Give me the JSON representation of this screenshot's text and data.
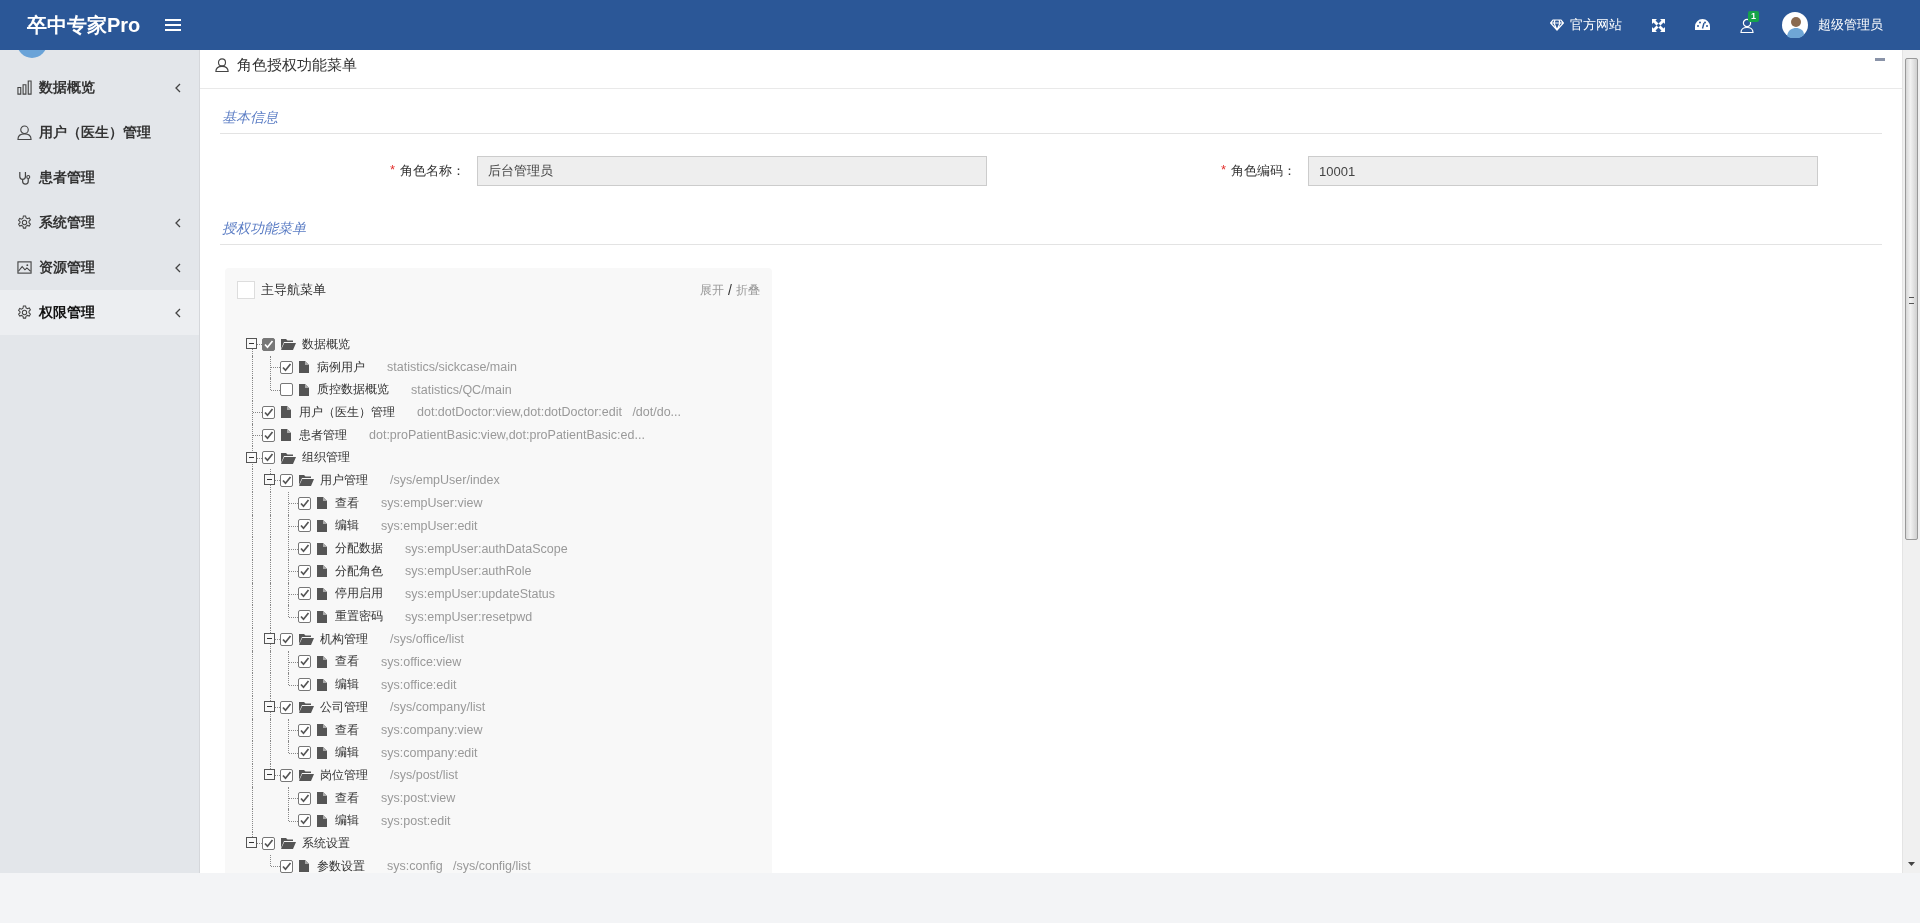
{
  "header": {
    "brand": "卒中专家Pro",
    "links": [
      {
        "kind": "website",
        "label": "官方网站"
      },
      {
        "kind": "fullscreen"
      },
      {
        "kind": "dashboard"
      },
      {
        "kind": "notifications",
        "badge": "1"
      }
    ],
    "user": {
      "name": "超级管理员"
    }
  },
  "sidebar": {
    "items": [
      {
        "label": "数据概览",
        "has_submenu": true,
        "selected": false
      },
      {
        "label": "用户（医生）管理",
        "has_submenu": false,
        "selected": false
      },
      {
        "label": "患者管理",
        "has_submenu": false,
        "selected": false
      },
      {
        "label": "系统管理",
        "has_submenu": true,
        "selected": false
      },
      {
        "label": "资源管理",
        "has_submenu": true,
        "selected": false
      },
      {
        "label": "权限管理",
        "has_submenu": true,
        "selected": true
      }
    ]
  },
  "panel": {
    "title": "角色授权功能菜单",
    "basic_info": {
      "title": "基本信息",
      "fields": [
        {
          "required_mark": "*",
          "label": "角色名称：",
          "value": "后台管理员",
          "readonly": true
        },
        {
          "required_mark": "*",
          "label": "角色编码：",
          "value": "10001",
          "readonly": true
        }
      ]
    },
    "menu_section": {
      "title": "授权功能菜单",
      "root": {
        "label": "主导航菜单",
        "checked": false
      },
      "expand_label": "展开",
      "separator": "/",
      "collapse_label": "折叠",
      "nodes": [
        {
          "label": "数据概览",
          "checked": true,
          "partial": true,
          "expanded": true,
          "children": [
            {
              "label": "病例用户",
              "permission": "statistics/sickcase/main",
              "checked": true
            },
            {
              "label": "质控数据概览",
              "permission": "statistics/QC/main",
              "checked": false
            }
          ]
        },
        {
          "label": "用户（医生）管理",
          "permission": "dot:dotDoctor:view,dot:dotDoctor:edit   /dot/do...",
          "checked": true
        },
        {
          "label": "患者管理",
          "permission": "dot:proPatientBasic:view,dot:proPatientBasic:ed...",
          "checked": true
        },
        {
          "label": "组织管理",
          "checked": true,
          "expanded": true,
          "children": [
            {
              "label": "用户管理",
              "permission": "/sys/empUser/index",
              "checked": true,
              "expanded": true,
              "children": [
                {
                  "label": "查看",
                  "permission": "sys:empUser:view",
                  "checked": true
                },
                {
                  "label": "编辑",
                  "permission": "sys:empUser:edit",
                  "checked": true
                },
                {
                  "label": "分配数据",
                  "permission": "sys:empUser:authDataScope",
                  "checked": true
                },
                {
                  "label": "分配角色",
                  "permission": "sys:empUser:authRole",
                  "checked": true
                },
                {
                  "label": "停用启用",
                  "permission": "sys:empUser:updateStatus",
                  "checked": true
                },
                {
                  "label": "重置密码",
                  "permission": "sys:empUser:resetpwd",
                  "checked": true
                }
              ]
            },
            {
              "label": "机构管理",
              "permission": "/sys/office/list",
              "checked": true,
              "expanded": true,
              "children": [
                {
                  "label": "查看",
                  "permission": "sys:office:view",
                  "checked": true
                },
                {
                  "label": "编辑",
                  "permission": "sys:office:edit",
                  "checked": true
                }
              ]
            },
            {
              "label": "公司管理",
              "permission": "/sys/company/list",
              "checked": true,
              "expanded": true,
              "children": [
                {
                  "label": "查看",
                  "permission": "sys:company:view",
                  "checked": true
                },
                {
                  "label": "编辑",
                  "permission": "sys:company:edit",
                  "checked": true
                }
              ]
            },
            {
              "label": "岗位管理",
              "permission": "/sys/post/list",
              "checked": true,
              "expanded": true,
              "children": [
                {
                  "label": "查看",
                  "permission": "sys:post:view",
                  "checked": true
                },
                {
                  "label": "编辑",
                  "permission": "sys:post:edit",
                  "checked": true
                }
              ]
            }
          ]
        },
        {
          "label": "系统设置",
          "checked": true,
          "expanded": true,
          "children": [
            {
              "label": "参数设置",
              "permission": "sys:config   /sys/config/list",
              "checked": true
            }
          ]
        }
      ]
    }
  }
}
